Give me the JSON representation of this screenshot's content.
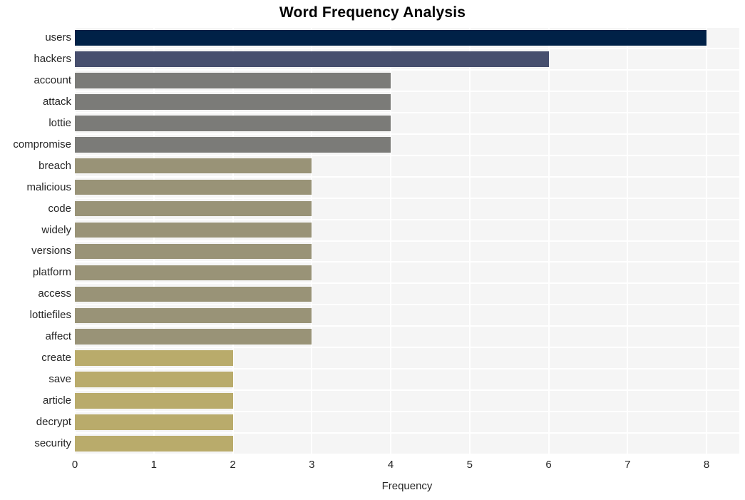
{
  "chart_data": {
    "type": "bar",
    "orientation": "horizontal",
    "title": "Word Frequency Analysis",
    "xlabel": "Frequency",
    "ylabel": "",
    "categories": [
      "users",
      "hackers",
      "account",
      "attack",
      "lottie",
      "compromise",
      "breach",
      "malicious",
      "code",
      "widely",
      "versions",
      "platform",
      "access",
      "lottiefiles",
      "affect",
      "create",
      "save",
      "article",
      "decrypt",
      "security"
    ],
    "values": [
      8,
      6,
      4,
      4,
      4,
      4,
      3,
      3,
      3,
      3,
      3,
      3,
      3,
      3,
      3,
      2,
      2,
      2,
      2,
      2
    ],
    "bar_colors": [
      "#002147",
      "#474f6e",
      "#7b7b78",
      "#7b7b78",
      "#7b7b78",
      "#7b7b78",
      "#999377",
      "#999377",
      "#999377",
      "#999377",
      "#999377",
      "#999377",
      "#999377",
      "#999377",
      "#999377",
      "#b9ab6b",
      "#b9ab6b",
      "#b9ab6b",
      "#b9ab6b",
      "#b9ab6b"
    ],
    "xlim": [
      0,
      8
    ],
    "xticks": [
      0,
      1,
      2,
      3,
      4,
      5,
      6,
      7,
      8
    ],
    "xtick_labels": [
      "0",
      "1",
      "2",
      "3",
      "4",
      "5",
      "6",
      "7",
      "8"
    ],
    "grid": true,
    "grid_color": "#ffffff",
    "plot_background": "#f5f5f5",
    "figure_background": "#ffffff",
    "legend": null
  }
}
